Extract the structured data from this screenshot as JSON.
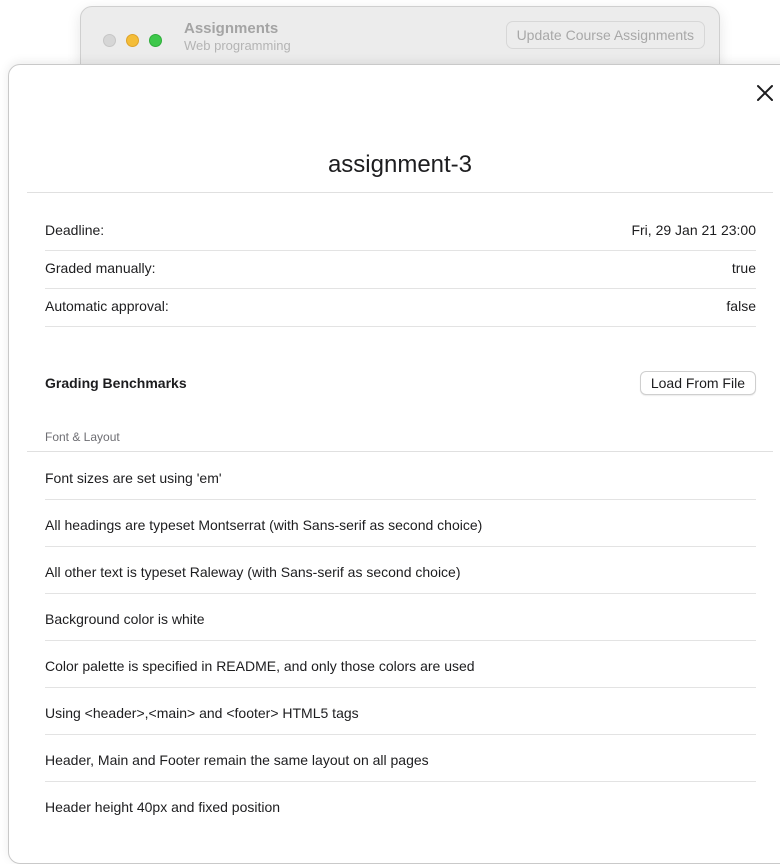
{
  "background_window": {
    "title": "Assignments",
    "subtitle": "Web programming",
    "update_button": "Update Course Assignments"
  },
  "sheet": {
    "title": "assignment-3",
    "details": [
      {
        "label": "Deadline:",
        "value": "Fri, 29 Jan 21 23:00"
      },
      {
        "label": "Graded manually:",
        "value": "true"
      },
      {
        "label": "Automatic approval:",
        "value": "false"
      }
    ],
    "benchmarks": {
      "title": "Grading Benchmarks",
      "load_button": "Load From File",
      "group_label": "Font & Layout",
      "items": [
        "Font sizes are set using 'em'",
        "All headings are typeset Montserrat (with Sans-serif as second choice)",
        "All other text is typeset Raleway (with Sans-serif as second choice)",
        "Background color is white",
        "Color palette is specified in README, and only those colors are used",
        "Using <header>,<main> and <footer> HTML5 tags",
        "Header, Main and Footer remain the same layout on all pages",
        "Header height 40px and fixed position"
      ]
    }
  }
}
